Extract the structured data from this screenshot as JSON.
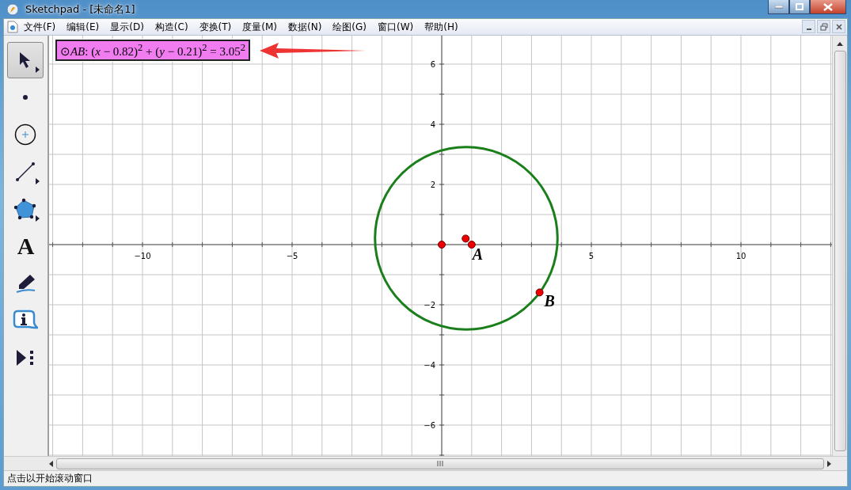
{
  "window": {
    "title": "Sketchpad  - [未命名1]"
  },
  "menu": [
    "文件(F)",
    "编辑(E)",
    "显示(D)",
    "构造(C)",
    "变换(T)",
    "度量(M)",
    "数据(N)",
    "绘图(G)",
    "窗口(W)",
    "帮助(H)"
  ],
  "tools": [
    {
      "kind": "arrow",
      "selected": true,
      "submenu": true
    },
    {
      "kind": "point",
      "selected": false,
      "submenu": false
    },
    {
      "kind": "compass",
      "selected": false,
      "submenu": false
    },
    {
      "kind": "segment",
      "selected": false,
      "submenu": true
    },
    {
      "kind": "polygon",
      "selected": false,
      "submenu": true
    },
    {
      "kind": "text",
      "glyph": "A",
      "selected": false,
      "submenu": false
    },
    {
      "kind": "marker",
      "selected": false,
      "submenu": false
    },
    {
      "kind": "info",
      "selected": false,
      "submenu": false
    },
    {
      "kind": "custom",
      "selected": false,
      "submenu": false
    }
  ],
  "canvas": {
    "equation": "⊙*AB*: (*x* − 0.82)$^{2}$ + (*y* − 0.21)$^{2}$ = 3.05$^{2}$",
    "x_tick_labels": [
      "−10",
      "−5",
      "5",
      "10"
    ],
    "y_tick_labels": [
      "6",
      "4",
      "2",
      "−2",
      "−4",
      "−6"
    ],
    "point_labels": [
      "A",
      "B"
    ]
  },
  "status_bar": "点击以开始滚动窗口"
}
